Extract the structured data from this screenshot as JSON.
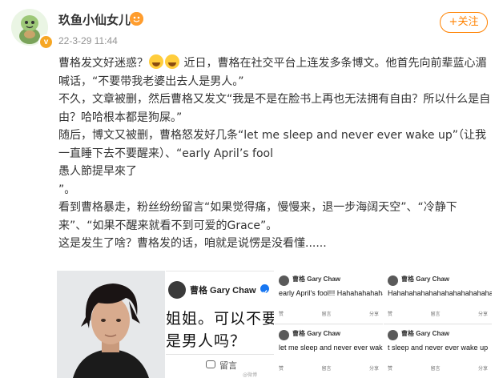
{
  "header": {
    "username": "玖鱼小仙女儿",
    "badge_letter": "v",
    "timestamp": "22-3-29 11:44",
    "follow_label": "+关注"
  },
  "post": {
    "para1_a": "曹格发文好迷惑？",
    "para1_b": " 近日，曹格在社交平台上连发多条博文。他首先向前辈蓝心湄喊话，“不要带我老婆出去人是男人。”",
    "para2": "不久，文章被删，然后曹格又发文“我是不是在脸书上再也无法拥有自由？所以什么是自由？哈哈根本都是狗屎。”",
    "para3": "随后，博文又被删，曹格怒发好几条“let me sleep and never ever wake up”（让我一直睡下去不要醒来）、“early April’s fool",
    "para4": "愚人節提早來了",
    "para5": "”。",
    "para6": "看到曹格暴走，粉丝纷纷留言“如果觉得痛，慢慢来，退一步海阔天空”、“冷静下来”、“如果不醒来就看不到可爱的Grace”。",
    "para7": "这是发生了啥？曹格发的话，咱就是说愣是没看懂......"
  },
  "images": {
    "tile2_name": "曹格 Gary Chaw",
    "tile2_line1": "姐姐。可以不要",
    "tile2_line2": "是男人吗？",
    "tile2_comment": "留言",
    "tile2_watermark": "@微博",
    "card_name": "曹格 Gary Chaw",
    "tile3_top_text": "early April's fool!!! Hahahahahahahah",
    "tile4_top_text": "Hahahahahahahahahahahahahah",
    "tile3_bottom_text": "let me sleep and never ever wake up",
    "tile4_bottom_text": "t sleep and never ever wake up",
    "action_like": "赞",
    "action_comment": "留言",
    "action_share": "分享"
  },
  "colors": {
    "accent": "#ff8200",
    "text": "#333333",
    "muted": "#939393"
  },
  "icons": {
    "avatar": "cartoon-turtle-avatar",
    "badge": "verified-badge-icon",
    "vip": "vip-fan-icon",
    "emoji": "laughing-crying-emoji"
  }
}
